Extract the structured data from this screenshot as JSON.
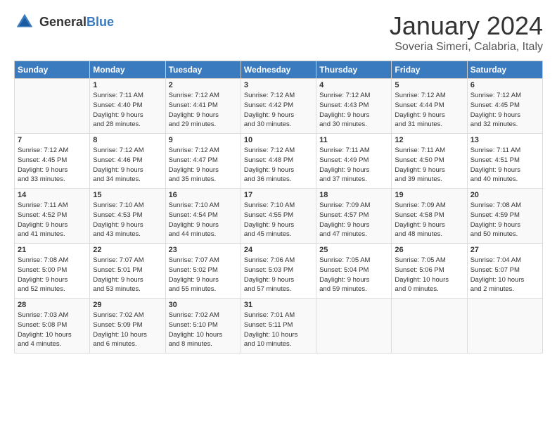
{
  "header": {
    "logo_general": "General",
    "logo_blue": "Blue",
    "month": "January 2024",
    "location": "Soveria Simeri, Calabria, Italy"
  },
  "weekdays": [
    "Sunday",
    "Monday",
    "Tuesday",
    "Wednesday",
    "Thursday",
    "Friday",
    "Saturday"
  ],
  "weeks": [
    [
      {
        "day": "",
        "info": ""
      },
      {
        "day": "1",
        "info": "Sunrise: 7:11 AM\nSunset: 4:40 PM\nDaylight: 9 hours\nand 28 minutes."
      },
      {
        "day": "2",
        "info": "Sunrise: 7:12 AM\nSunset: 4:41 PM\nDaylight: 9 hours\nand 29 minutes."
      },
      {
        "day": "3",
        "info": "Sunrise: 7:12 AM\nSunset: 4:42 PM\nDaylight: 9 hours\nand 30 minutes."
      },
      {
        "day": "4",
        "info": "Sunrise: 7:12 AM\nSunset: 4:43 PM\nDaylight: 9 hours\nand 30 minutes."
      },
      {
        "day": "5",
        "info": "Sunrise: 7:12 AM\nSunset: 4:44 PM\nDaylight: 9 hours\nand 31 minutes."
      },
      {
        "day": "6",
        "info": "Sunrise: 7:12 AM\nSunset: 4:45 PM\nDaylight: 9 hours\nand 32 minutes."
      }
    ],
    [
      {
        "day": "7",
        "info": "Sunrise: 7:12 AM\nSunset: 4:45 PM\nDaylight: 9 hours\nand 33 minutes."
      },
      {
        "day": "8",
        "info": "Sunrise: 7:12 AM\nSunset: 4:46 PM\nDaylight: 9 hours\nand 34 minutes."
      },
      {
        "day": "9",
        "info": "Sunrise: 7:12 AM\nSunset: 4:47 PM\nDaylight: 9 hours\nand 35 minutes."
      },
      {
        "day": "10",
        "info": "Sunrise: 7:12 AM\nSunset: 4:48 PM\nDaylight: 9 hours\nand 36 minutes."
      },
      {
        "day": "11",
        "info": "Sunrise: 7:11 AM\nSunset: 4:49 PM\nDaylight: 9 hours\nand 37 minutes."
      },
      {
        "day": "12",
        "info": "Sunrise: 7:11 AM\nSunset: 4:50 PM\nDaylight: 9 hours\nand 39 minutes."
      },
      {
        "day": "13",
        "info": "Sunrise: 7:11 AM\nSunset: 4:51 PM\nDaylight: 9 hours\nand 40 minutes."
      }
    ],
    [
      {
        "day": "14",
        "info": "Sunrise: 7:11 AM\nSunset: 4:52 PM\nDaylight: 9 hours\nand 41 minutes."
      },
      {
        "day": "15",
        "info": "Sunrise: 7:10 AM\nSunset: 4:53 PM\nDaylight: 9 hours\nand 43 minutes."
      },
      {
        "day": "16",
        "info": "Sunrise: 7:10 AM\nSunset: 4:54 PM\nDaylight: 9 hours\nand 44 minutes."
      },
      {
        "day": "17",
        "info": "Sunrise: 7:10 AM\nSunset: 4:55 PM\nDaylight: 9 hours\nand 45 minutes."
      },
      {
        "day": "18",
        "info": "Sunrise: 7:09 AM\nSunset: 4:57 PM\nDaylight: 9 hours\nand 47 minutes."
      },
      {
        "day": "19",
        "info": "Sunrise: 7:09 AM\nSunset: 4:58 PM\nDaylight: 9 hours\nand 48 minutes."
      },
      {
        "day": "20",
        "info": "Sunrise: 7:08 AM\nSunset: 4:59 PM\nDaylight: 9 hours\nand 50 minutes."
      }
    ],
    [
      {
        "day": "21",
        "info": "Sunrise: 7:08 AM\nSunset: 5:00 PM\nDaylight: 9 hours\nand 52 minutes."
      },
      {
        "day": "22",
        "info": "Sunrise: 7:07 AM\nSunset: 5:01 PM\nDaylight: 9 hours\nand 53 minutes."
      },
      {
        "day": "23",
        "info": "Sunrise: 7:07 AM\nSunset: 5:02 PM\nDaylight: 9 hours\nand 55 minutes."
      },
      {
        "day": "24",
        "info": "Sunrise: 7:06 AM\nSunset: 5:03 PM\nDaylight: 9 hours\nand 57 minutes."
      },
      {
        "day": "25",
        "info": "Sunrise: 7:05 AM\nSunset: 5:04 PM\nDaylight: 9 hours\nand 59 minutes."
      },
      {
        "day": "26",
        "info": "Sunrise: 7:05 AM\nSunset: 5:06 PM\nDaylight: 10 hours\nand 0 minutes."
      },
      {
        "day": "27",
        "info": "Sunrise: 7:04 AM\nSunset: 5:07 PM\nDaylight: 10 hours\nand 2 minutes."
      }
    ],
    [
      {
        "day": "28",
        "info": "Sunrise: 7:03 AM\nSunset: 5:08 PM\nDaylight: 10 hours\nand 4 minutes."
      },
      {
        "day": "29",
        "info": "Sunrise: 7:02 AM\nSunset: 5:09 PM\nDaylight: 10 hours\nand 6 minutes."
      },
      {
        "day": "30",
        "info": "Sunrise: 7:02 AM\nSunset: 5:10 PM\nDaylight: 10 hours\nand 8 minutes."
      },
      {
        "day": "31",
        "info": "Sunrise: 7:01 AM\nSunset: 5:11 PM\nDaylight: 10 hours\nand 10 minutes."
      },
      {
        "day": "",
        "info": ""
      },
      {
        "day": "",
        "info": ""
      },
      {
        "day": "",
        "info": ""
      }
    ]
  ]
}
